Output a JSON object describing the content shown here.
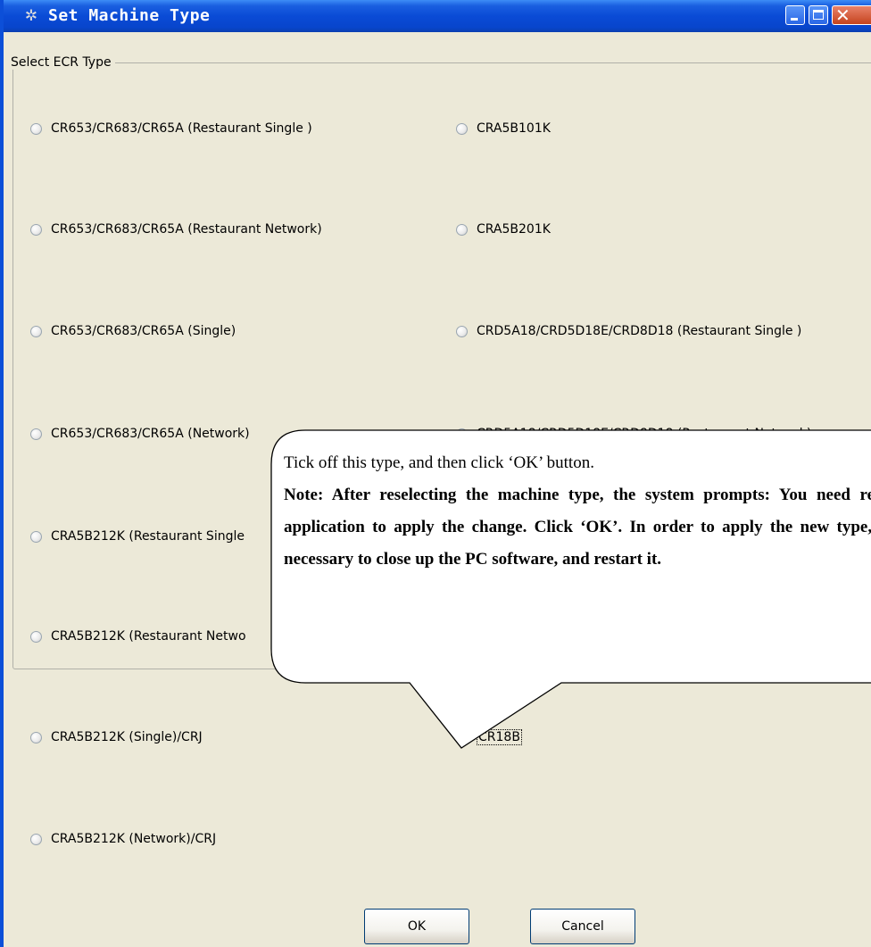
{
  "window": {
    "title": "Set Machine Type",
    "title_icon": "gear-icon"
  },
  "group": {
    "label": "Select ECR Type"
  },
  "options_left": [
    {
      "label": "CR653/CR683/CR65A (Restaurant Single )",
      "checked": false
    },
    {
      "label": "CR653/CR683/CR65A (Restaurant Network)",
      "checked": false
    },
    {
      "label": "CR653/CR683/CR65A (Single)",
      "checked": false
    },
    {
      "label": "CR653/CR683/CR65A (Network)",
      "checked": false
    },
    {
      "label": "CRA5B212K (Restaurant Single",
      "checked": false
    },
    {
      "label": "CRA5B212K (Restaurant Netwo",
      "checked": false
    },
    {
      "label": "CRA5B212K (Single)/CRJ",
      "checked": false
    },
    {
      "label": "CRA5B212K (Network)/CRJ",
      "checked": false
    }
  ],
  "options_right": [
    {
      "label": "CRA5B101K",
      "checked": false
    },
    {
      "label": "CRA5B201K",
      "checked": false
    },
    {
      "label": "CRD5A18/CRD5D18E/CRD8D18 (Restaurant Single )",
      "checked": false
    },
    {
      "label": "CRD5A18/CRD5D18E/CRD8D18 (Restaurant Network)",
      "checked": false
    },
    {
      "label": "CR18B",
      "checked": true
    }
  ],
  "buttons": {
    "ok": "OK",
    "cancel": "Cancel"
  },
  "callout": {
    "line1": "Tick off this type, and then click ‘OK’ button.",
    "note": "Note: After reselecting the machine type, the system prompts: You need restart application to apply the change. Click ‘OK’. In order to apply the new type, it is necessary to close up the PC software, and restart it."
  }
}
